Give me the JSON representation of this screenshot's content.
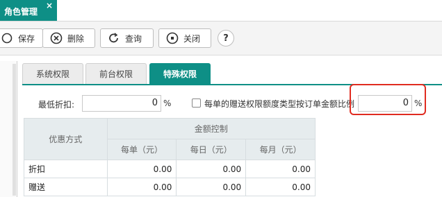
{
  "window_tab": {
    "title": "角色管理",
    "close": "×"
  },
  "toolbar": {
    "save_label": "保存",
    "delete_label": "删除",
    "query_label": "查询",
    "close_label": "关闭",
    "help_label": "?"
  },
  "subtabs": [
    {
      "label": "系统权限",
      "active": false
    },
    {
      "label": "前台权限",
      "active": false
    },
    {
      "label": "特殊权限",
      "active": true
    }
  ],
  "discount": {
    "min_label": "最低折扣:",
    "min_value": "0",
    "unit": "%",
    "gift_checkbox_label": "每单的赠送权限额度类型按订单金额比例",
    "gift_checked": false,
    "gift_value": "0",
    "gift_unit": "%"
  },
  "table": {
    "col_method": "优惠方式",
    "group_header": "金额控制",
    "sub_headers": [
      "每单（元）",
      "每日（元）",
      "每月（元）"
    ],
    "rows": [
      {
        "label": "折扣",
        "values": [
          "0.00",
          "0.00",
          "0.00"
        ]
      },
      {
        "label": "赠送",
        "values": [
          "0.00",
          "0.00",
          "0.00"
        ]
      }
    ]
  },
  "colors": {
    "accent": "#0e8f86",
    "highlight": "#e02b20"
  }
}
